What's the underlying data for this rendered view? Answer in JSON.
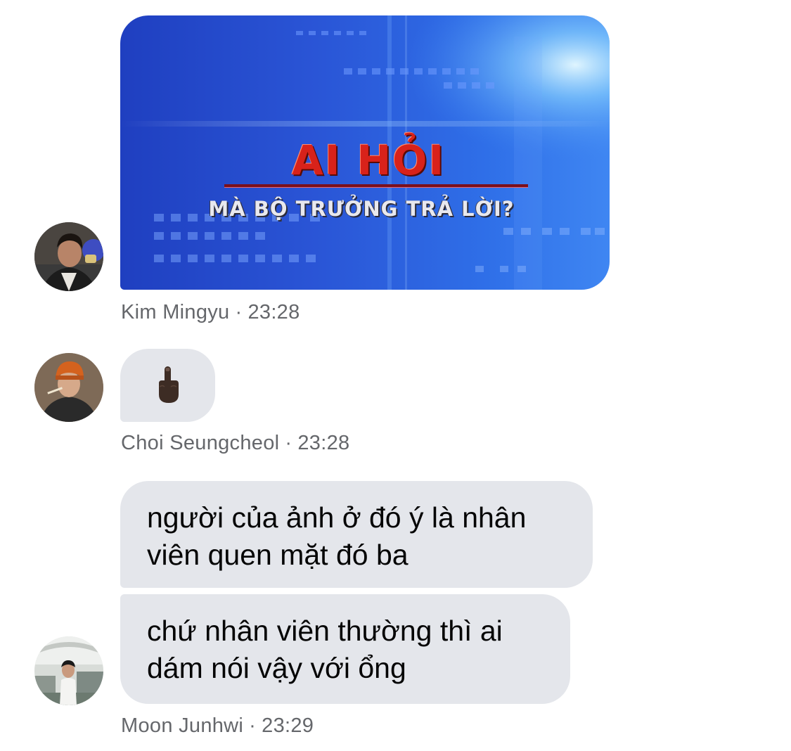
{
  "messages": [
    {
      "sender": "Kim Mingyu",
      "time": "23:28",
      "type": "image",
      "image": {
        "title": "AI HỎI",
        "subtitle": "MÀ BỘ TRƯỞNG TRẢ LỜI?"
      }
    },
    {
      "sender": "Choi Seungcheol",
      "time": "23:28",
      "type": "emoji",
      "emoji": "middle-finger-dark-skin-tone"
    },
    {
      "sender": "Moon Junhwi",
      "time": "23:29",
      "type": "text",
      "lines": [
        "người của ảnh ở đó ý là nhân\nviên quen mặt đó ba",
        "chứ nhân viên thường thì ai\ndám nói vậy với ổng"
      ]
    }
  ],
  "separator": "·",
  "colors": {
    "bubble": "#e4e6eb",
    "meta_text": "#65676b",
    "message_text": "#050505",
    "image_bg": "#2a55d6",
    "title_red": "#d8221a"
  }
}
